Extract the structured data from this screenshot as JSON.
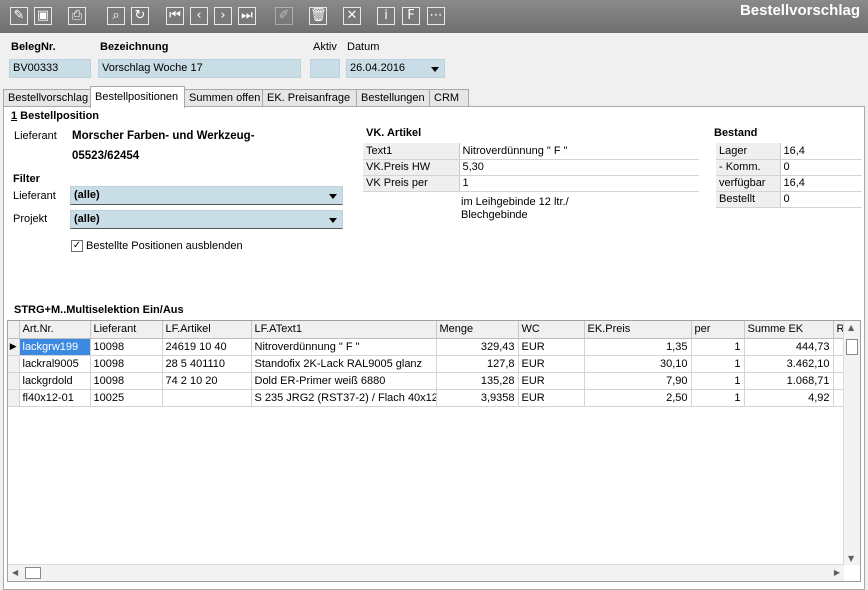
{
  "app_title": "Bestellvorschlag",
  "toolbar": {
    "icons": [
      "edit-icon",
      "save-icon",
      "print-icon",
      "search-icon",
      "refresh-icon",
      "first-record-icon",
      "previous-record-icon",
      "next-record-icon",
      "last-record-icon",
      "pencil-icon",
      "delete-icon",
      "close-icon",
      "info-icon",
      "format-icon",
      "more-icon"
    ]
  },
  "header": {
    "belegnr_label": "BelegNr.",
    "belegnr_value": "BV00333",
    "bezeichnung_label": "Bezeichnung",
    "bezeichnung_value": "Vorschlag Woche 17",
    "aktiv_label": "Aktiv",
    "aktiv_value": "",
    "datum_label": "Datum",
    "datum_value": "26.04.2016"
  },
  "tabs": [
    "Bestellvorschlag",
    "Bestellpositionen",
    "Summen offen",
    "EK. Preisanfrage",
    "Bestellungen",
    "CRM"
  ],
  "active_tab": "Bestellpositionen",
  "position": {
    "section_number": "1",
    "section_title": " Bestellposition",
    "lieferant_label": "Lieferant",
    "lieferant_name": "Morscher Farben- und Werkzeug-",
    "lieferant_code": "05523/62454"
  },
  "filter": {
    "title": "Filter",
    "lieferant_label": "Lieferant",
    "lieferant_value": "(alle)",
    "projekt_label": "Projekt",
    "projekt_value": "(alle)",
    "hide_ordered_label": "Bestellte Positionen ausblenden",
    "hide_ordered_checked": true
  },
  "vk_artikel": {
    "title": "VK. Artikel",
    "rows": [
      {
        "key": "Text1",
        "value": "Nitroverdünnung \" F \""
      },
      {
        "key": "VK.Preis HW",
        "value": "5,30"
      },
      {
        "key": "VK Preis per",
        "value": "1"
      }
    ],
    "note_line1": "im Leihgebinde 12 ltr./",
    "note_line2": "Blechgebinde"
  },
  "bestand": {
    "title": "Bestand",
    "rows": [
      {
        "key": "Lager",
        "value": "16,4"
      },
      {
        "key": "- Komm.",
        "value": "0"
      },
      {
        "key": "verfügbar",
        "value": "16,4"
      },
      {
        "key": "Bestellt",
        "value": "0"
      }
    ]
  },
  "grid": {
    "caption": "STRG+M..Multiselektion Ein/Aus",
    "columns": [
      "Art.Nr.",
      "Lieferant",
      "LF.Artikel",
      "LF.AText1",
      "Menge",
      "WC",
      "EK.Preis",
      "per",
      "Summe EK",
      "R"
    ],
    "rows": [
      [
        "lackgrw199",
        "10098",
        "24619 10 40",
        "Nitroverdünnung \" F \"",
        "329,43",
        "EUR",
        "1,35",
        "1",
        "444,73",
        ""
      ],
      [
        "lackral9005",
        "10098",
        "28 5 401110",
        "Standofix 2K-Lack RAL9005 glanz",
        "127,8",
        "EUR",
        "30,10",
        "1",
        "3.462,10",
        ""
      ],
      [
        "lackgrdold",
        "10098",
        "74 2 10 20",
        "Dold ER-Primer weiß 6880",
        "135,28",
        "EUR",
        "7,90",
        "1",
        "1.068,71",
        ""
      ],
      [
        "fl40x12-01",
        "10025",
        "",
        "S 235 JRG2 (RST37-2) / Flach 40x12",
        "3,9358",
        "EUR",
        "2,50",
        "1",
        "4,92",
        ""
      ]
    ]
  }
}
